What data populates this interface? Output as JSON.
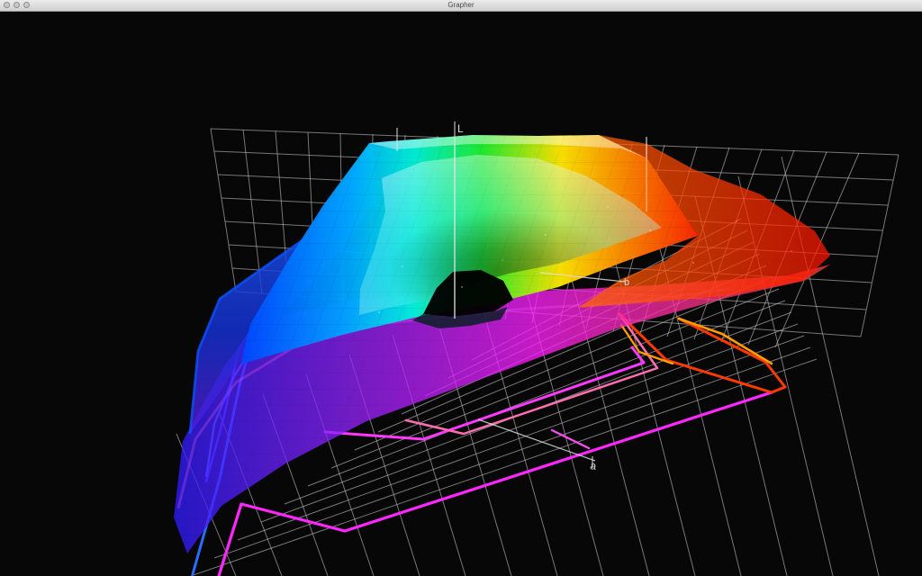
{
  "window": {
    "title": "Grapher"
  },
  "plot": {
    "axes": {
      "vertical": "L",
      "depth": "b",
      "horizontal": "a"
    },
    "colors": {
      "background": "#070707",
      "grid": "#bdbdbd",
      "cyan": "#00ffff",
      "green": "#22e040",
      "yellow": "#ffe300",
      "orange": "#ff7a00",
      "red": "#ff1c00",
      "magenta": "#ff20ff",
      "purple": "#7a20ff",
      "blue": "#0044ff"
    }
  }
}
